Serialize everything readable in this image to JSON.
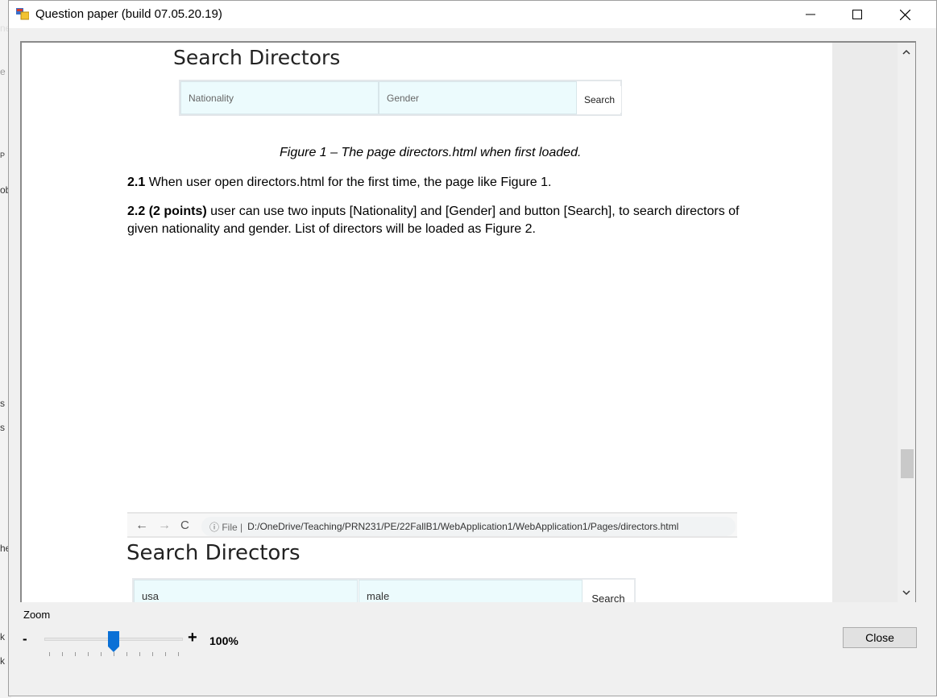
{
  "background_app": {
    "fragments": [
      "ne",
      "e",
      "P",
      "ob",
      "s",
      "s",
      "he",
      "k",
      "k"
    ]
  },
  "window": {
    "title": "Question paper (build 07.05.20.19)",
    "icons": {
      "app": "app-icon",
      "minimize": "minimize-icon",
      "maximize": "maximize-icon",
      "close": "close-icon"
    }
  },
  "document": {
    "figure1": {
      "heading": "Search Directors",
      "nationality_placeholder": "Nationality",
      "gender_placeholder": "Gender",
      "search_label": "Search"
    },
    "caption": "Figure 1 – The page directors.html when first loaded.",
    "p21_num": "2.1",
    "p21_text": " When user open directors.html for the first time, the page like Figure 1.",
    "p22_bold": "2.2 (2 points)",
    "p22_text": " user can use two inputs [Nationality] and [Gender] and button [Search], to search directors of given nationality and gender. List of directors will be loaded as Figure 2.",
    "figure2": {
      "nav": {
        "back": "←",
        "forward": "→",
        "reload": "C"
      },
      "address_prefix": "ⓘ File |",
      "address": "D:/OneDrive/Teaching/PRN231/PE/22FallB1/WebApplication1/WebApplication1/Pages/directors.html",
      "heading": "Search Directors",
      "nationality_value": "usa",
      "gender_value": "male",
      "search_label": "Search"
    }
  },
  "zoom": {
    "label": "Zoom",
    "minus": "-",
    "plus": "+",
    "value": "100%",
    "level": 0.5
  },
  "buttons": {
    "close": "Close"
  }
}
